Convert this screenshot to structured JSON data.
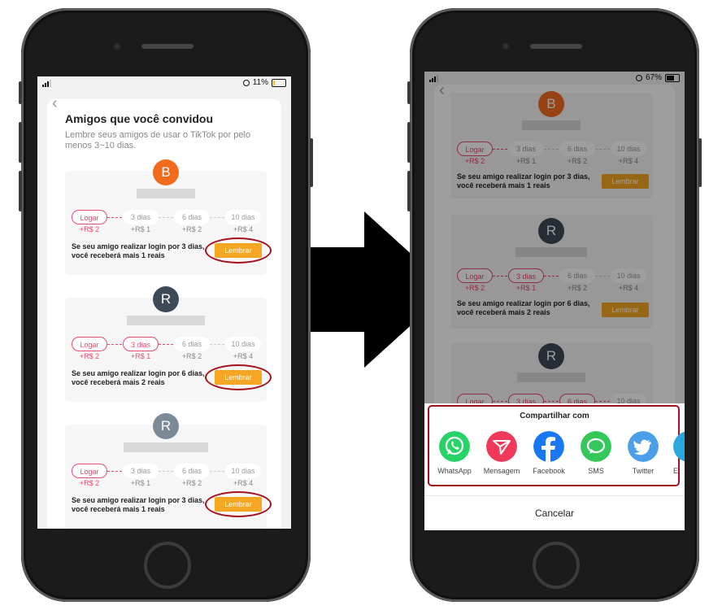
{
  "left_screen": {
    "status": {
      "battery": "11%"
    },
    "header": {
      "back_icon": "chevron-left-icon",
      "title": "Amigos que você convidou",
      "subtitle_line1": "Lembre seus amigos de usar o TikTok por pelo",
      "subtitle_line2": "menos 3~10 dias."
    },
    "cards": [
      {
        "avatar_letter": "B",
        "avatar_color": "#f26b1d",
        "steps": [
          {
            "label": "Logar",
            "reward": "+R$ 2",
            "active": true
          },
          {
            "label": "3 dias",
            "reward": "+R$ 1",
            "active": false
          },
          {
            "label": "6 dias",
            "reward": "+R$ 2",
            "active": false
          },
          {
            "label": "10 dias",
            "reward": "+R$ 4",
            "active": false
          }
        ],
        "message_line1": "Se seu amigo realizar login por 3 dias,",
        "message_line2": "você receberá mais 1 reais",
        "button": "Lembrar"
      },
      {
        "avatar_letter": "R",
        "avatar_color": "#3e4a57",
        "steps": [
          {
            "label": "Logar",
            "reward": "+R$ 2",
            "active": true
          },
          {
            "label": "3 dias",
            "reward": "+R$ 1",
            "active": true
          },
          {
            "label": "6 dias",
            "reward": "+R$ 2",
            "active": false
          },
          {
            "label": "10 dias",
            "reward": "+R$ 4",
            "active": false
          }
        ],
        "message_line1": "Se seu amigo realizar login por 6 dias,",
        "message_line2": "você receberá mais 2 reais",
        "button": "Lembrar"
      },
      {
        "avatar_letter": "R",
        "avatar_color": "#7b8a96",
        "steps": [
          {
            "label": "Logar",
            "reward": "+R$ 2",
            "active": true
          },
          {
            "label": "3 dias",
            "reward": "+R$ 1",
            "active": false
          },
          {
            "label": "6 dias",
            "reward": "+R$ 2",
            "active": false
          },
          {
            "label": "10 dias",
            "reward": "+R$ 4",
            "active": false
          }
        ],
        "message_line1": "Se seu amigo realizar login por 3 dias,",
        "message_line2": "você receberá mais 1 reais",
        "button": "Lembrar"
      }
    ]
  },
  "right_screen": {
    "status": {
      "battery": "67%"
    },
    "cards": [
      {
        "avatar_letter": "B",
        "avatar_color": "#f26b1d",
        "steps": [
          {
            "label": "Logar",
            "reward": "+R$ 2",
            "active": true
          },
          {
            "label": "3 dias",
            "reward": "+R$ 1",
            "active": false
          },
          {
            "label": "6 dias",
            "reward": "+R$ 2",
            "active": false
          },
          {
            "label": "10 dias",
            "reward": "+R$ 4",
            "active": false
          }
        ],
        "message_line1": "Se seu amigo realizar login por 3 dias,",
        "message_line2": "você receberá mais 1 reais",
        "button": "Lembrar"
      },
      {
        "avatar_letter": "R",
        "avatar_color": "#3e4a57",
        "steps": [
          {
            "label": "Logar",
            "reward": "+R$ 2",
            "active": true
          },
          {
            "label": "3 dias",
            "reward": "+R$ 1",
            "active": true
          },
          {
            "label": "6 dias",
            "reward": "+R$ 2",
            "active": false
          },
          {
            "label": "10 dias",
            "reward": "+R$ 4",
            "active": false
          }
        ],
        "message_line1": "Se seu amigo realizar login por 6 dias,",
        "message_line2": "você receberá mais 2 reais",
        "button": "Lembrar"
      },
      {
        "avatar_letter": "R",
        "avatar_color": "#3e4a57",
        "steps": [
          {
            "label": "Logar",
            "reward": "",
            "active": true
          },
          {
            "label": "3 dias",
            "reward": "",
            "active": true
          },
          {
            "label": "6 dias",
            "reward": "",
            "active": true
          },
          {
            "label": "10 dias",
            "reward": "",
            "active": false
          }
        ],
        "message_line1": "",
        "message_line2": "",
        "button": ""
      }
    ],
    "share_sheet": {
      "title": "Compartilhar com",
      "apps": [
        {
          "label": "WhatsApp",
          "icon": "whatsapp-icon",
          "color": "#25d366"
        },
        {
          "label": "Mensagem",
          "icon": "message-send-icon",
          "color": "#f0385a"
        },
        {
          "label": "Facebook",
          "icon": "facebook-icon",
          "color": "#1877f2"
        },
        {
          "label": "SMS",
          "icon": "sms-icon",
          "color": "#34c759"
        },
        {
          "label": "Twitter",
          "icon": "twitter-icon",
          "color": "#4a9fe8"
        },
        {
          "label": "E",
          "icon": "partial-app-icon",
          "color": "#29a9e0"
        }
      ],
      "cancel": "Cancelar"
    }
  },
  "arrow_icon": "right-arrow-icon",
  "colors": {
    "accent": "#e84b6b",
    "button": "#f5a623",
    "highlight": "#a4111c"
  }
}
